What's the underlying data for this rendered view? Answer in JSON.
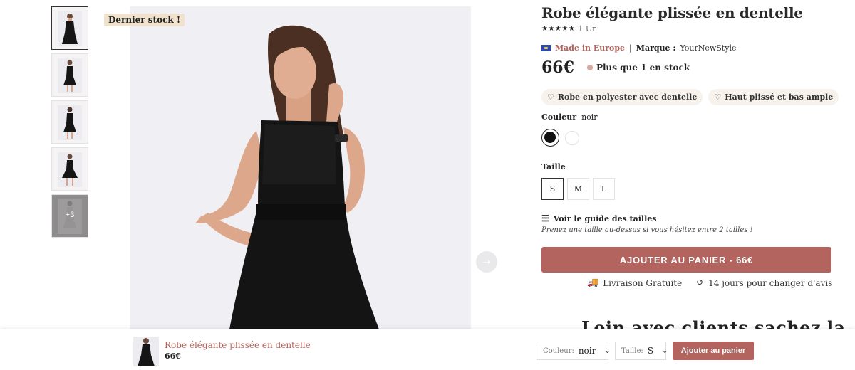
{
  "gallery": {
    "badge": "Dernier stock !",
    "more_label": "+3",
    "thumbnail_count": 5
  },
  "product": {
    "title": "Robe élégante plissée en dentelle",
    "rating_stars": "★★★★★",
    "rating_count": "1 Un",
    "made_in": "Made in Europe",
    "brand_label": "Marque :",
    "brand_value": "YourNewStyle",
    "price": "66€",
    "stock_text": "Plus que 1 en stock",
    "features": [
      "Robe en polyester avec dentelle",
      "Haut plissé et bas ample"
    ],
    "color_label": "Couleur",
    "color_value": "noir",
    "size_label": "Taille",
    "sizes": [
      "S",
      "M",
      "L"
    ],
    "selected_size": "S",
    "guide_label": "Voir le guide des tailles",
    "guide_hint": "Prenez une taille au-dessus si vous hésitez entre 2 tailles !",
    "cart_button": "AJOUTER AU PANIER - 66€",
    "perks": [
      "Livraison Gratuite",
      "14 jours pour changer d'avis"
    ],
    "cutoff_heading": "Loin avec clients sachez la"
  },
  "sticky_bar": {
    "name": "Robe élégante plissée en dentelle",
    "price": "66€",
    "color_label": "Couleur:",
    "color_value": "noir",
    "size_label": "Taille:",
    "size_value": "S",
    "add_button": "Ajouter au panier"
  },
  "colors": {
    "accent": "#b4645e",
    "badge_bg": "#f1e2cd",
    "feature_bg": "#f8f2ec"
  }
}
